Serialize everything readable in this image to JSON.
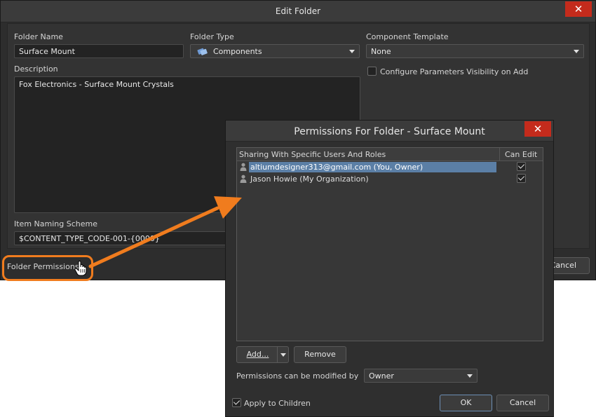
{
  "edit_folder": {
    "title": "Edit Folder",
    "close_glyph": "✕",
    "folder_name_label": "Folder Name",
    "folder_name_value": "Surface Mount",
    "folder_type_label": "Folder Type",
    "folder_type_value": "Components",
    "component_template_label": "Component Template",
    "component_template_value": "None",
    "configure_params_label": "Configure Parameters Visibility on Add",
    "description_label": "Description",
    "description_value": "Fox Electronics - Surface Mount Crystals",
    "naming_scheme_label": "Item Naming Scheme",
    "naming_scheme_value": "$CONTENT_TYPE_CODE-001-{0000}",
    "folder_permissions_label": "Folder Permissions...",
    "cancel_label": "Cancel"
  },
  "permissions": {
    "title": "Permissions For Folder - Surface Mount",
    "close_glyph": "✕",
    "columns": {
      "sharing": "Sharing With Specific Users And Roles",
      "can_edit": "Can Edit"
    },
    "rows": [
      {
        "name": "altiumdesigner313@gmail.com (You, Owner)",
        "can_edit": true,
        "selected": true
      },
      {
        "name": "Jason Howie (My Organization)",
        "can_edit": true,
        "selected": false
      }
    ],
    "add_label": "Add...",
    "remove_label": "Remove",
    "modified_by_label": "Permissions can be modified by",
    "modified_by_value": "Owner",
    "apply_children_label": "Apply to Children",
    "ok_label": "OK",
    "cancel_label": "Cancel"
  },
  "colors": {
    "accent_orange": "#f07c1e",
    "selection_blue": "#5b7fa6",
    "close_red": "#c42b1c"
  },
  "icons": [
    "close-icon",
    "components-icon",
    "dropdown-arrow-icon",
    "user-icon",
    "hand-cursor-icon",
    "checkmark-icon"
  ]
}
